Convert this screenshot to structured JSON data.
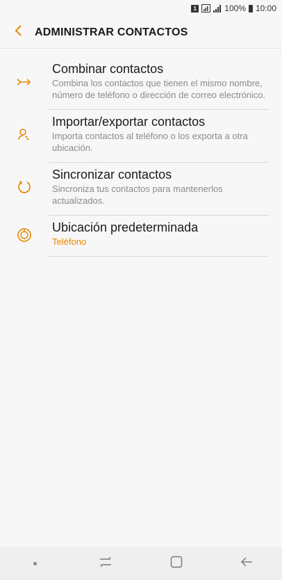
{
  "status_bar": {
    "sim_label": "1",
    "battery_text": "100%",
    "time": "10:00"
  },
  "header": {
    "title": "ADMINISTRAR CONTACTOS",
    "back_icon": "chevron-left-icon"
  },
  "accent_color": "#e68600",
  "items": [
    {
      "icon": "merge-arrows-icon",
      "title": "Combinar contactos",
      "description": "Combina los contactos que tienen el mismo nombre, número de teléfono o dirección de correo electrónico."
    },
    {
      "icon": "import-export-contact-icon",
      "title": "Importar/exportar contactos",
      "description": "Importa contactos al teléfono o los exporta a otra ubicación."
    },
    {
      "icon": "sync-icon",
      "title": "Sincronizar contactos",
      "description": "Sincroniza tus contactos para mantenerlos actualizados."
    },
    {
      "icon": "storage-location-icon",
      "title": "Ubicación predeterminada",
      "value": "Teléfono"
    }
  ],
  "nav_bar": {
    "buttons": [
      "dot-icon",
      "recents-icon",
      "home-icon",
      "back-arrow-icon"
    ]
  }
}
